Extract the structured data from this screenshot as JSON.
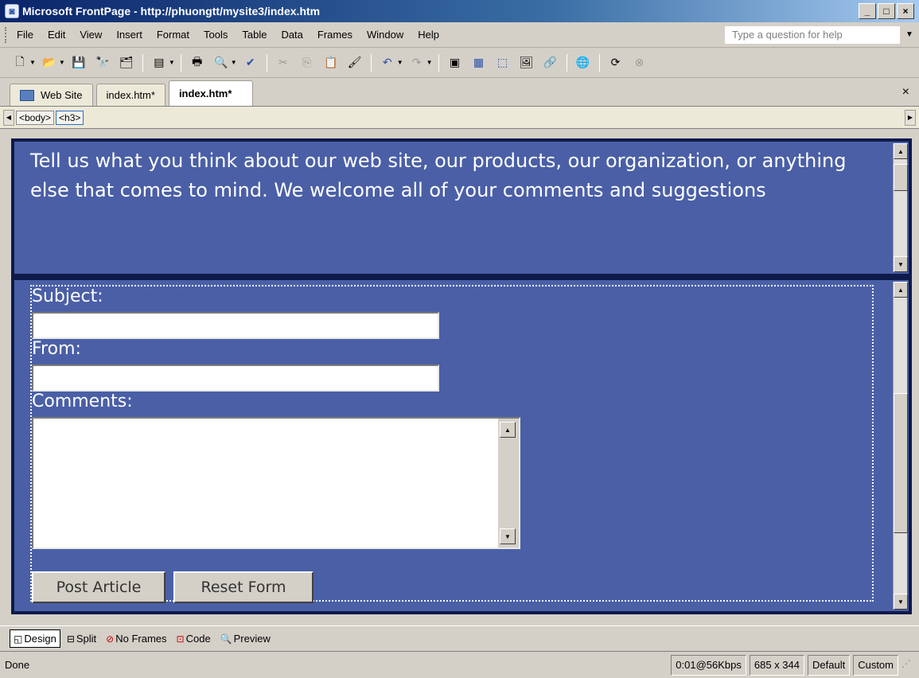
{
  "window": {
    "title": "Microsoft FrontPage - http://phuongtt/mysite3/index.htm",
    "minimize": "_",
    "maximize": "□",
    "close": "×"
  },
  "menu": {
    "items": [
      "File",
      "Edit",
      "View",
      "Insert",
      "Format",
      "Tools",
      "Table",
      "Data",
      "Frames",
      "Window",
      "Help"
    ],
    "help_placeholder": "Type a question for help"
  },
  "toolbar": {
    "icons": [
      "new-page-icon",
      "open-icon",
      "save-icon",
      "search-icon",
      "publish-icon",
      "layer-icon",
      "print-icon",
      "print-preview-icon",
      "spelling-icon",
      "cut-icon",
      "copy-icon",
      "paste-icon",
      "format-painter-icon",
      "undo-icon",
      "redo-icon",
      "web-component-icon",
      "insert-table-icon",
      "insert-layer-icon",
      "insert-picture-icon",
      "hyperlink-icon",
      "web-icon",
      "refresh-icon",
      "stop-icon"
    ]
  },
  "tabs": {
    "items": [
      "Web Site",
      "index.htm*",
      "index.htm*"
    ],
    "close": "×"
  },
  "tagbar": {
    "tags": [
      "<body>",
      "<h3>"
    ]
  },
  "page": {
    "header_text": "Tell us what you think about our web site, our products, our organization, or anything else that comes to mind. We welcome all of your comments and suggestions",
    "labels": {
      "subject": "Subject:",
      "from": "From:",
      "comments": "Comments:"
    },
    "buttons": {
      "post": "Post Article",
      "reset": "Reset Form"
    }
  },
  "viewbar": {
    "design": "Design",
    "split": "Split",
    "no_frames": "No Frames",
    "code": "Code",
    "preview": "Preview"
  },
  "status": {
    "left": "Done",
    "speed": "0:01@56Kbps",
    "size": "685 x 344",
    "default": "Default",
    "custom": "Custom"
  }
}
